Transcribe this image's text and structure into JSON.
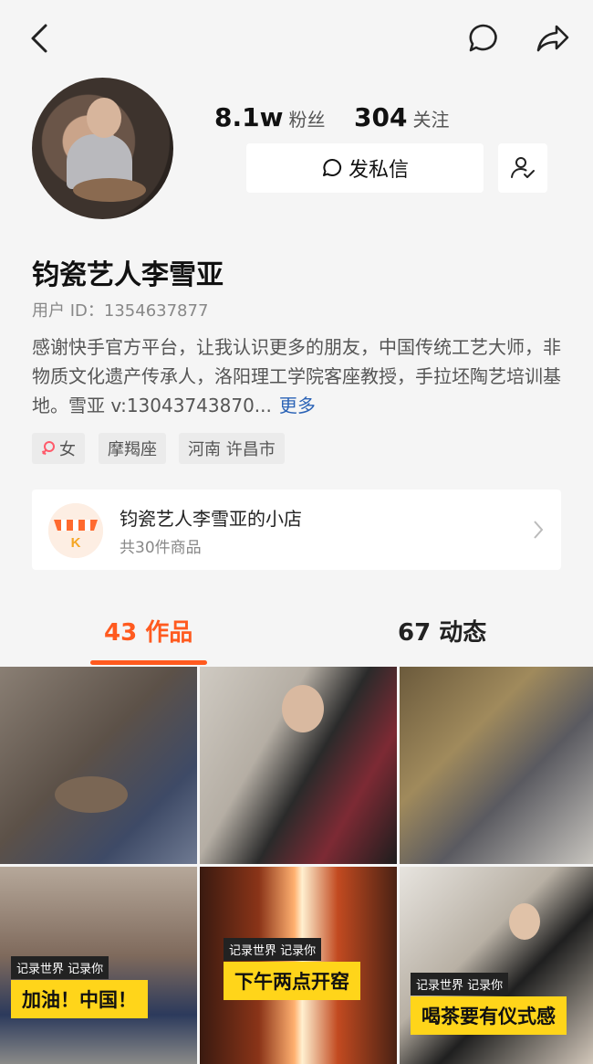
{
  "profile": {
    "fans_count": "8.1w",
    "fans_label": "粉丝",
    "following_count": "304",
    "following_label": "关注",
    "message_button": "发私信",
    "name": "钧瓷艺人李雪亚",
    "user_id": "用户 ID：1354637877",
    "bio": "感谢快手官方平台，让我认识更多的朋友，中国传统工艺大师，非物质文化遗产传承人，洛阳理工学院客座教授，手拉坯陶艺培训基地。雪亚 v:13043743870...",
    "bio_more": "更多",
    "tags": [
      {
        "label": "女",
        "icon": "female-icon"
      },
      {
        "label": "摩羯座"
      },
      {
        "label": "河南 许昌市"
      }
    ]
  },
  "shop": {
    "title": "钧瓷艺人李雪亚的小店",
    "subtitle": "共30件商品",
    "logo_letter": "K"
  },
  "tabs": [
    {
      "count": "43",
      "label": "作品",
      "active": true
    },
    {
      "count": "67",
      "label": "动态",
      "active": false
    }
  ],
  "grid": [
    {
      "caption_small": "",
      "caption_big": ""
    },
    {
      "caption_small": "",
      "caption_big": ""
    },
    {
      "caption_small": "",
      "caption_big": ""
    },
    {
      "caption_small": "记录世界 记录你",
      "caption_big": "加油！中国！"
    },
    {
      "caption_small": "记录世界 记录你",
      "caption_big": "下午两点开窑"
    },
    {
      "caption_small": "记录世界 记录你",
      "caption_big": "喝茶要有仪式感"
    }
  ],
  "colors": {
    "accent": "#ff5a1f",
    "link": "#2b63b6",
    "caption_yellow": "#ffd51a"
  }
}
